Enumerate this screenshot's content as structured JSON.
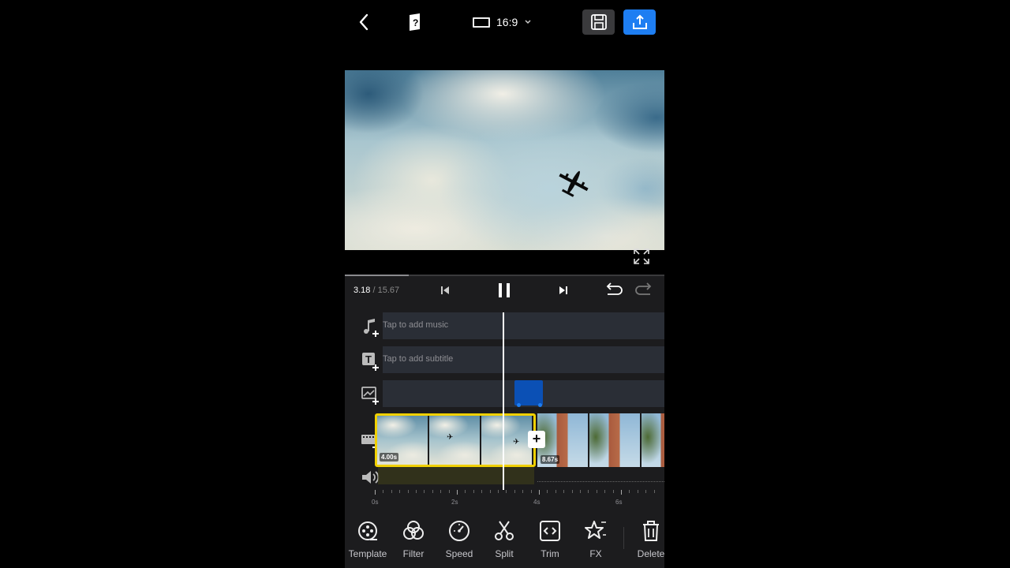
{
  "header": {
    "aspect_ratio": "16:9"
  },
  "playback": {
    "current_time": "3.18",
    "separator": " / ",
    "total_time": "15.67",
    "progress_fraction": 0.2
  },
  "tracks": {
    "music_hint": "Tap to add music",
    "subtitle_hint": "Tap to add subtitle"
  },
  "clips": [
    {
      "duration": "4.00s",
      "selected": true
    },
    {
      "duration": "8.67s",
      "selected": false
    }
  ],
  "ruler": {
    "labels": [
      "0s",
      "2s",
      "4s",
      "6s"
    ]
  },
  "toolbar": {
    "items": [
      {
        "label": "Template",
        "icon": "template-icon"
      },
      {
        "label": "Filter",
        "icon": "filter-icon"
      },
      {
        "label": "Speed",
        "icon": "speed-icon"
      },
      {
        "label": "Split",
        "icon": "scissors-icon"
      },
      {
        "label": "Trim",
        "icon": "trim-icon"
      },
      {
        "label": "FX",
        "icon": "fx-star-icon"
      },
      {
        "label": "Delete",
        "icon": "trash-icon"
      }
    ]
  },
  "colors": {
    "accent": "#1e7ef2",
    "selection": "#f0d000",
    "sticker": "#0b50b5"
  }
}
